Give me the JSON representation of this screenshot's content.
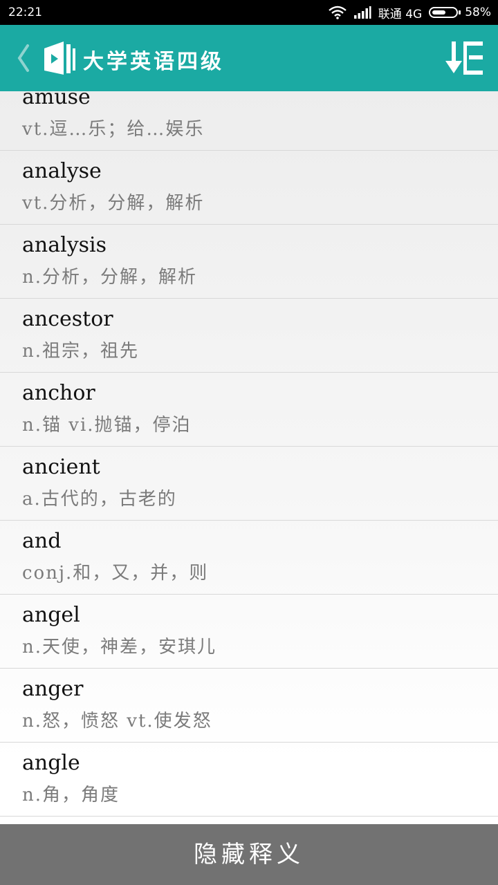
{
  "status_bar": {
    "time": "22:21",
    "carrier": "联通 4G",
    "battery": "58%",
    "battery_level": 0.58
  },
  "header": {
    "title": "大学英语四级",
    "back_icon": "chevron-left-icon",
    "logo_icon": "book-play-logo",
    "sort_icon": "sort-list-icon",
    "accent_color": "#1baaa3"
  },
  "words": [
    {
      "term": "amuse",
      "definition": "vt.逗…乐；给…娱乐"
    },
    {
      "term": "analyse",
      "definition": "vt.分析，分解，解析"
    },
    {
      "term": "analysis",
      "definition": "n.分析，分解，解析"
    },
    {
      "term": "ancestor",
      "definition": "n.祖宗，祖先"
    },
    {
      "term": "anchor",
      "definition": "n.锚 vi.抛锚，停泊"
    },
    {
      "term": "ancient",
      "definition": "a.古代的，古老的"
    },
    {
      "term": "and",
      "definition": "conj.和，又，并，则"
    },
    {
      "term": "angel",
      "definition": "n.天使，神差，安琪儿"
    },
    {
      "term": "anger",
      "definition": "n.怒，愤怒 vt.使发怒"
    },
    {
      "term": "angle",
      "definition": "n.角，角度"
    }
  ],
  "footer": {
    "hide_label": "隐藏释义"
  }
}
